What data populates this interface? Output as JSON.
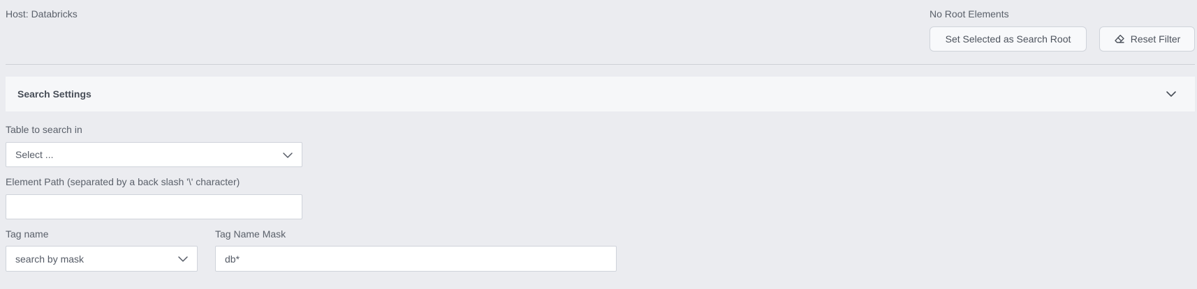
{
  "header": {
    "host_label": "Host: Databricks",
    "root_status": "No Root Elements",
    "set_root_label": "Set Selected as Search Root",
    "reset_filter_label": "Reset Filter"
  },
  "search_settings": {
    "title": "Search Settings",
    "expanded": true
  },
  "form": {
    "table_label": "Table to search in",
    "table_value": "Select ...",
    "path_label": "Element Path (separated by a back slash '\\' character)",
    "path_value": "",
    "tag_name_label": "Tag name",
    "tag_name_value": "search by mask",
    "tag_mask_label": "Tag Name Mask",
    "tag_mask_value": "db*"
  },
  "icons": {
    "reset": "eraser-icon",
    "accordion": "chevron-down-icon",
    "select": "chevron-down-icon"
  },
  "colors": {
    "background": "#ebecf0",
    "panel": "#f6f7f9",
    "border": "#cfd3da",
    "text": "#555b66"
  }
}
